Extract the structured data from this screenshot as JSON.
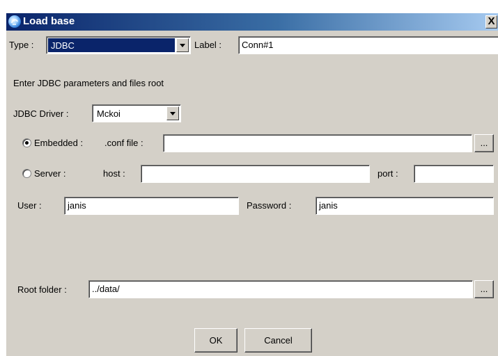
{
  "window": {
    "title": "Load base",
    "close_glyph": "X"
  },
  "type_row": {
    "type_label": "Type :",
    "type_value": "JDBC",
    "label_label": "Label :",
    "label_value": "Conn#1"
  },
  "instructions": "Enter JDBC parameters and files root",
  "driver": {
    "label": "JDBC Driver :",
    "value": "Mckoi"
  },
  "embedded": {
    "radio_label": "Embedded :",
    "selected": true,
    "conf_label": ".conf file :",
    "conf_value": "",
    "browse_label": "..."
  },
  "server": {
    "radio_label": "Server :",
    "selected": false,
    "host_label": "host :",
    "host_value": "",
    "port_label": "port :",
    "port_value": ""
  },
  "credentials": {
    "user_label": "User :",
    "user_value": "janis",
    "password_label": "Password :",
    "password_value": "janis"
  },
  "root": {
    "label": "Root folder :",
    "value": "../data/",
    "browse_label": "..."
  },
  "buttons": {
    "ok": "OK",
    "cancel": "Cancel"
  },
  "icons": {
    "app": "app-icon",
    "radio_on": "radio-selected-icon",
    "radio_off": "radio-unselected-icon",
    "dropdown": "chevron-down-icon"
  }
}
